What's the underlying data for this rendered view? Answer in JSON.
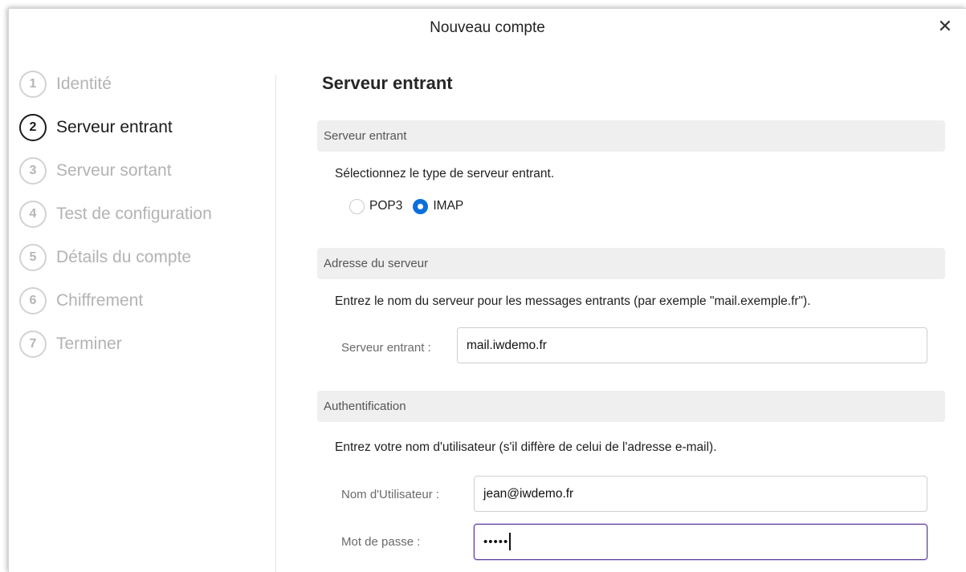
{
  "window": {
    "title": "Nouveau compte",
    "close_glyph": "✕"
  },
  "steps": [
    {
      "number": "1",
      "label": "Identité",
      "active": false
    },
    {
      "number": "2",
      "label": "Serveur entrant",
      "active": true
    },
    {
      "number": "3",
      "label": "Serveur sortant",
      "active": false
    },
    {
      "number": "4",
      "label": "Test de configuration",
      "active": false
    },
    {
      "number": "5",
      "label": "Détails du compte",
      "active": false
    },
    {
      "number": "6",
      "label": "Chiffrement",
      "active": false
    },
    {
      "number": "7",
      "label": "Terminer",
      "active": false
    }
  ],
  "main": {
    "title": "Serveur entrant",
    "server_type": {
      "header": "Serveur entrant",
      "description": "Sélectionnez le type de serveur entrant.",
      "options": [
        {
          "label": "POP3",
          "checked": false
        },
        {
          "label": "IMAP",
          "checked": true
        }
      ]
    },
    "server_address": {
      "header": "Adresse du serveur",
      "description": "Entrez le nom du serveur pour les messages entrants (par exemple \"mail.exemple.fr\").",
      "label": "Serveur entrant :",
      "value": "mail.iwdemo.fr"
    },
    "authentication": {
      "header": "Authentification",
      "description": "Entrez votre nom d'utilisateur (s'il diffère de celui de l'adresse e-mail).",
      "username_label": "Nom d'Utilisateur :",
      "username_value": "jean@iwdemo.fr",
      "password_label": "Mot de passe :",
      "password_masked": "•••••"
    }
  },
  "colors": {
    "accent": "#0b6fdc",
    "focus_border": "#5a3a9a",
    "section_bg": "#efefef",
    "inactive_step": "#b3b3b3"
  }
}
